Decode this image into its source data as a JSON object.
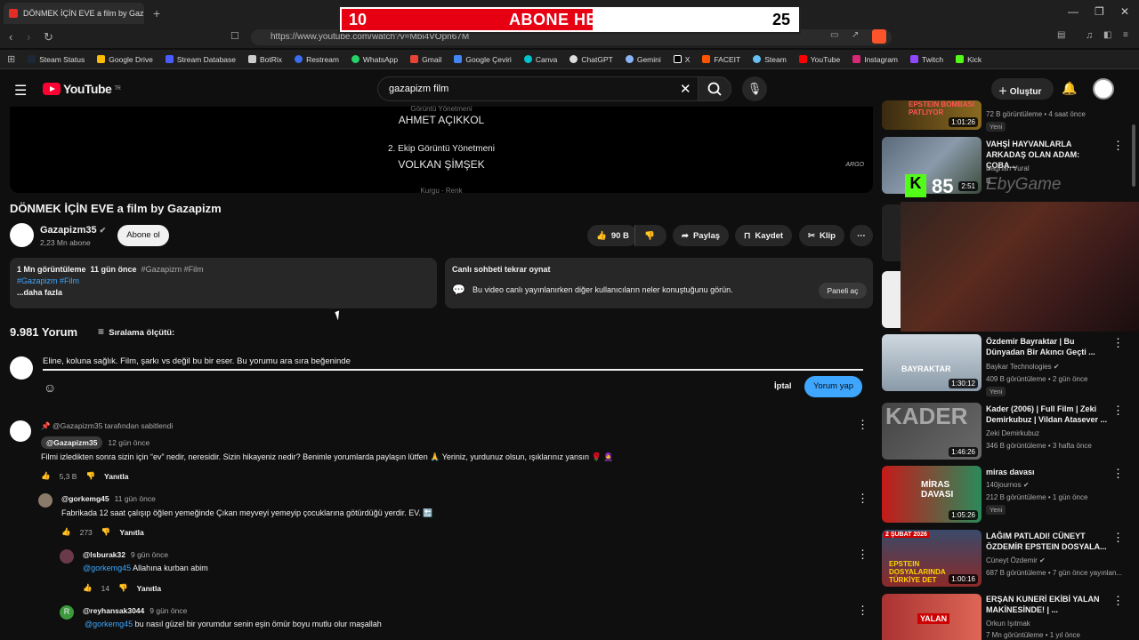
{
  "browser": {
    "tab_title": "DÖNMEK İÇİN EVE a film by Gaz",
    "tab_close": "✕",
    "new_tab": "+",
    "url": "https://www.youtube.com/watch?v=Mbi4VOpn67M",
    "bookmarks": [
      "Steam Status",
      "Google Drive",
      "Stream Database",
      "BotRix",
      "Restream",
      "WhatsApp",
      "Gmail",
      "Google Çeviri",
      "Canva",
      "ChatGPT",
      "Gemini",
      "X",
      "FACEIT",
      "Steam",
      "YouTube",
      "Instagram",
      "Twitch",
      "Kick"
    ]
  },
  "overlay": {
    "current": "10",
    "label": "ABONE HEDEFİ",
    "target": "25",
    "progress": 0.4
  },
  "kick_overlay": {
    "badge": "K",
    "value": "85",
    "brand": "EbyGame"
  },
  "youtube": {
    "logo": "YouTube",
    "logo_sup": "TR",
    "search_value": "gazapizm film",
    "create_label": "Oluştur"
  },
  "video": {
    "credit_top": "Görüntü Yönetmeni",
    "credit1": "AHMET AÇIKKOL",
    "credit_role2": "2. Ekip Görüntü Yönetmeni",
    "credit2": "VOLKAN ŞİMŞEK",
    "credit_bottom": "Kurgu - Renk",
    "watermark": "ARGO",
    "title": "DÖNMEK İÇİN EVE a film by Gazapizm"
  },
  "channel": {
    "name": "Gazapizm35",
    "subs": "2,23 Mn abone",
    "subscribe": "Abone ol"
  },
  "actions": {
    "likes": "90 B",
    "share": "Paylaş",
    "save": "Kaydet",
    "clip": "Klip"
  },
  "description": {
    "views": "1 Mn görüntüleme",
    "ago": "11 gün önce",
    "tags": "#Gazapizm #Film",
    "tags2": "#Gazapizm #Film",
    "more": "...daha fazla"
  },
  "chat": {
    "title": "Canlı sohbeti tekrar oynat",
    "text": "Bu video canlı yayınlanırken diğer kullanıcıların neler konuştuğunu görün.",
    "button": "Paneli aç"
  },
  "comments_header": {
    "count": "9.981 Yorum",
    "sort": "Sıralama ölçütü:"
  },
  "comment_input": {
    "value": "Eline, koluna sağlık. Film, şarkı vs değil bu bir eser. Bu yorumu ara sıra beğeninde",
    "cancel": "İptal",
    "post": "Yorum yap"
  },
  "comments": [
    {
      "pinned": "@Gazapizm35 tarafından sabitlendi",
      "author": "@Gazapizm35",
      "time": "12 gün önce",
      "text": "Filmi izledikten sonra sizin için “ev” nedir, neresidir. Sizin hikayeniz nedir? Benimle yorumlarda paylaşın lütfen 🙏 Yeriniz, yurdunuz olsun, ışıklarınız yansın 🌹 🧕",
      "likes": "5,3 B",
      "reply": "Yanıtla"
    },
    {
      "author": "@gorkemg45",
      "time": "11 gün önce",
      "text": "Fabrikada 12 saat çalışıp öğlen yemeğinde Çıkan meyveyi yemeyip çocuklarına götürdüğü yerdir. EV. 🔚",
      "likes": "273",
      "reply": "Yanıtla"
    },
    {
      "author": "@lsburak32",
      "time": "9 gün önce",
      "mention": "@gorkemg45",
      "text": " Allahına kurban abim",
      "likes": "14",
      "reply": "Yanıtla"
    },
    {
      "author": "@reyhansak3044",
      "time": "9 gün önce",
      "mention": "@gorkemg45",
      "text": " bu nasıl güzel bir yorumdur senin eşin ömür boyu mutlu olur maşallah",
      "avatar_letter": "R"
    }
  ],
  "sidebar": [
    {
      "thumb_text": "EPSTEIN BOMBASI PATLIYOR",
      "duration": "1:01:26",
      "views": "72 B görüntüleme • 4 saat önce",
      "badge": "Yeni"
    },
    {
      "title": "VAHŞİ HAYVANLARLA ARKADAŞ OLAN ADAM: ÇOBA...",
      "channel": "Dağhan Vural",
      "duration": "2:51",
      "views": "B"
    },
    {
      "title": "Özdemir Bayraktar | Bu Dünyadan Bir Akıncı Geçti ...",
      "channel": "Baykar Technologies",
      "views": "409 B görüntüleme • 2 gün önce",
      "badge": "Yeni",
      "duration": "1:30:12",
      "thumb_text": "BAYRAKTAR"
    },
    {
      "title": "Kader (2006) | Full Film | Zeki Demirkubuz | Vildan Atasever ...",
      "channel": "Zeki Demirkubuz",
      "views": "346 B görüntüleme • 3 hafta önce",
      "duration": "1:46:26",
      "thumb_text": "KADER"
    },
    {
      "title": "miras davası",
      "channel": "140journos",
      "views": "212 B görüntüleme • 1 gün önce",
      "badge": "Yeni",
      "duration": "1:05:26",
      "thumb_text": "MİRAS DAVASI"
    },
    {
      "title": "LAĞIM PATLADI! CÜNEYT ÖZDEMİR EPSTEIN DOSYALA...",
      "channel": "Cüneyt Özdemir",
      "views": "687 B görüntüleme • 7 gün önce yayınlan...",
      "duration": "1:00:16",
      "thumb_text": "EPSTEIN DOSYALARINDA TÜRKİYE DET",
      "thumb_date": "2 ŞUBAT 2026"
    },
    {
      "title": "ERŞAN KUNERİ EKİBİ YALAN MAKİNESİNDE! | ...",
      "channel": "Orkun Işıtmak",
      "views": "7 Mn görüntüleme • 1 yıl önce",
      "thumb_text": "YALAN"
    }
  ]
}
